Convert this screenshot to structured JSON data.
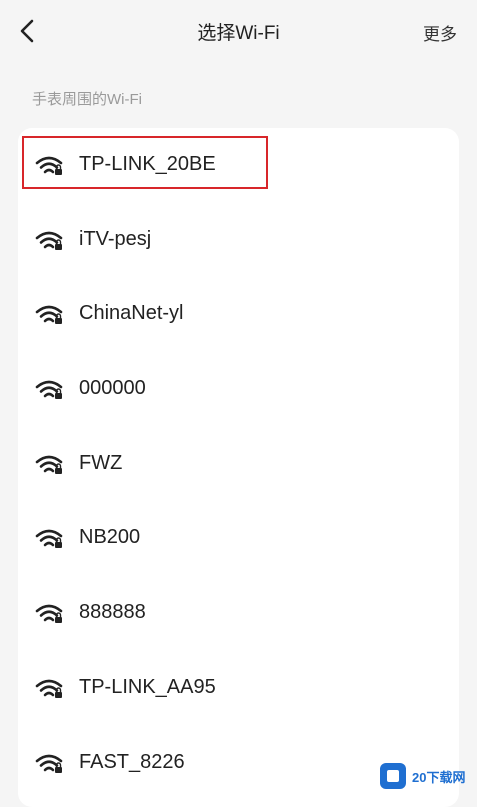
{
  "header": {
    "back_icon": "chevron-left-icon",
    "title": "选择Wi-Fi",
    "more_label": "更多"
  },
  "section": {
    "label": "手表周围的Wi-Fi"
  },
  "networks": [
    {
      "ssid": "TP-LINK_20BE",
      "icon": "wifi-signal-icon",
      "highlighted": true
    },
    {
      "ssid": "iTV-pesj",
      "icon": "wifi-signal-icon"
    },
    {
      "ssid": "ChinaNet-yl",
      "icon": "wifi-signal-icon"
    },
    {
      "ssid": "000000",
      "icon": "wifi-signal-icon"
    },
    {
      "ssid": "FWZ",
      "icon": "wifi-signal-icon"
    },
    {
      "ssid": "NB200",
      "icon": "wifi-signal-icon"
    },
    {
      "ssid": "888888",
      "icon": "wifi-signal-icon"
    },
    {
      "ssid": "TP-LINK_AA95",
      "icon": "wifi-signal-icon"
    },
    {
      "ssid": "FAST_8226",
      "icon": "wifi-signal-icon"
    }
  ],
  "colors": {
    "background": "#f5f5f5",
    "card": "#ffffff",
    "highlight_border": "#d8262a",
    "secondary_text": "#9a9a9a"
  },
  "watermark": {
    "brand_text": "20下载网"
  }
}
